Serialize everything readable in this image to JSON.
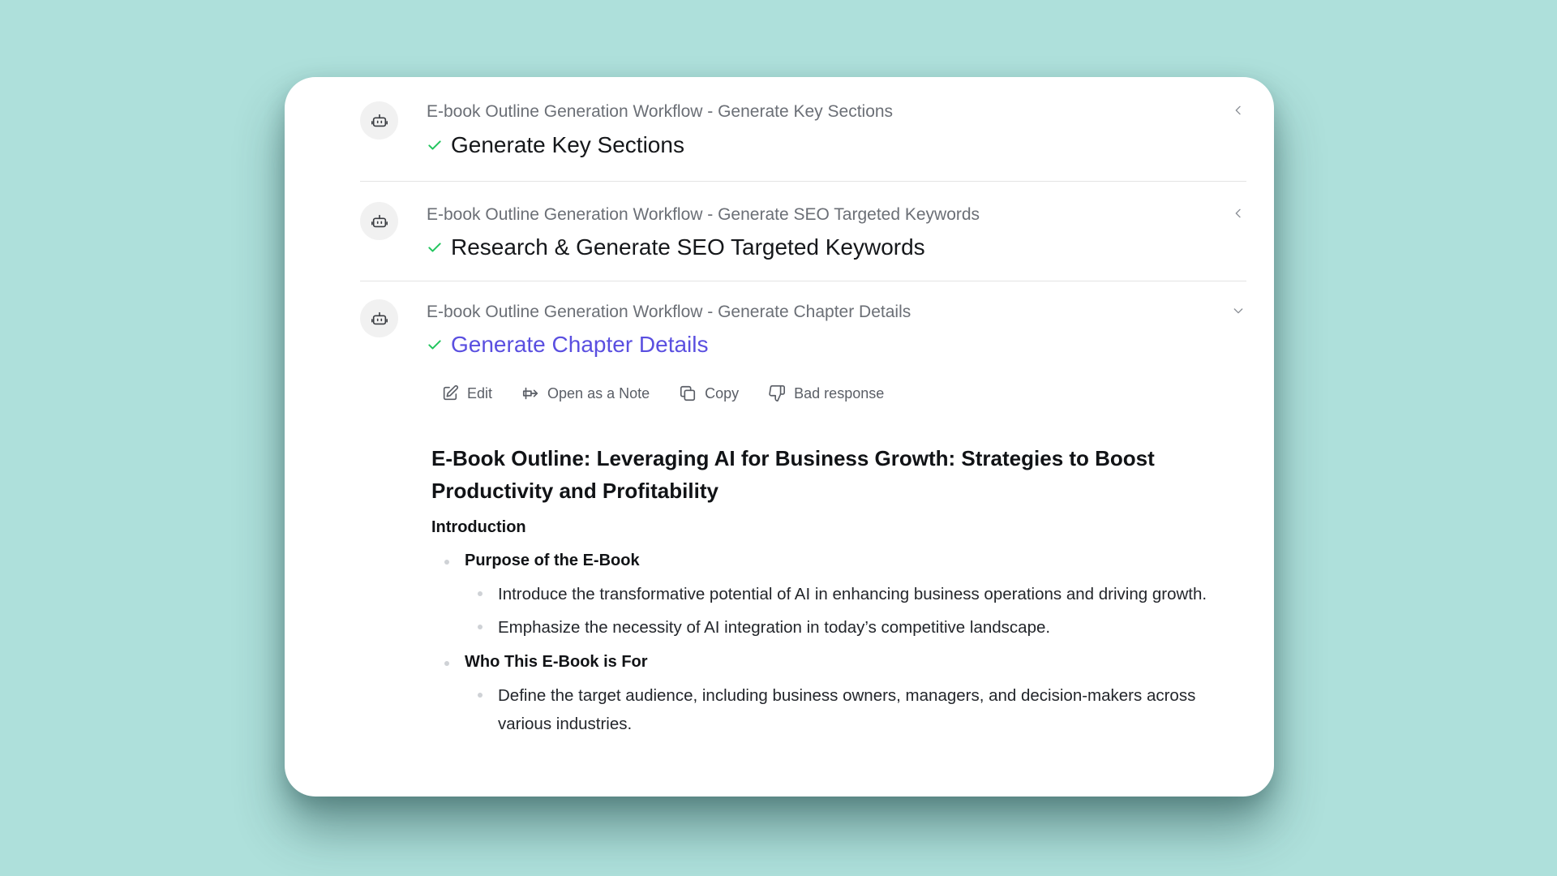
{
  "steps": [
    {
      "subtitle": "E-book Outline Generation Workflow - Generate Key Sections",
      "title": "Generate Key Sections",
      "state": "collapsed"
    },
    {
      "subtitle": "E-book Outline Generation Workflow - Generate SEO Targeted Keywords",
      "title": "Research & Generate SEO Targeted Keywords",
      "state": "collapsed"
    },
    {
      "subtitle": "E-book Outline Generation Workflow - Generate Chapter Details",
      "title": "Generate Chapter Details",
      "state": "expanded"
    }
  ],
  "actions": {
    "edit": "Edit",
    "open_note": "Open as a Note",
    "copy": "Copy",
    "bad_response": "Bad response"
  },
  "content": {
    "title": "E-Book Outline: Leveraging AI for Business Growth: Strategies to Boost Productivity and Profitability",
    "section": "Introduction",
    "items": [
      {
        "heading": "Purpose of the E-Book",
        "points": [
          "Introduce the transformative potential of AI in enhancing business operations and driving growth.",
          "Emphasize the necessity of AI integration in today’s competitive landscape."
        ]
      },
      {
        "heading": "Who This E-Book is For",
        "points": [
          "Define the target audience, including business owners, managers, and decision-makers across various industries."
        ]
      }
    ]
  },
  "colors": {
    "background": "#aee0db",
    "accent": "#5a4fe0",
    "check": "#22c55e"
  },
  "icons": {
    "avatar": "robot-icon",
    "check": "check-icon",
    "collapsed": "chevron-left-icon",
    "expanded": "chevron-down-icon"
  }
}
